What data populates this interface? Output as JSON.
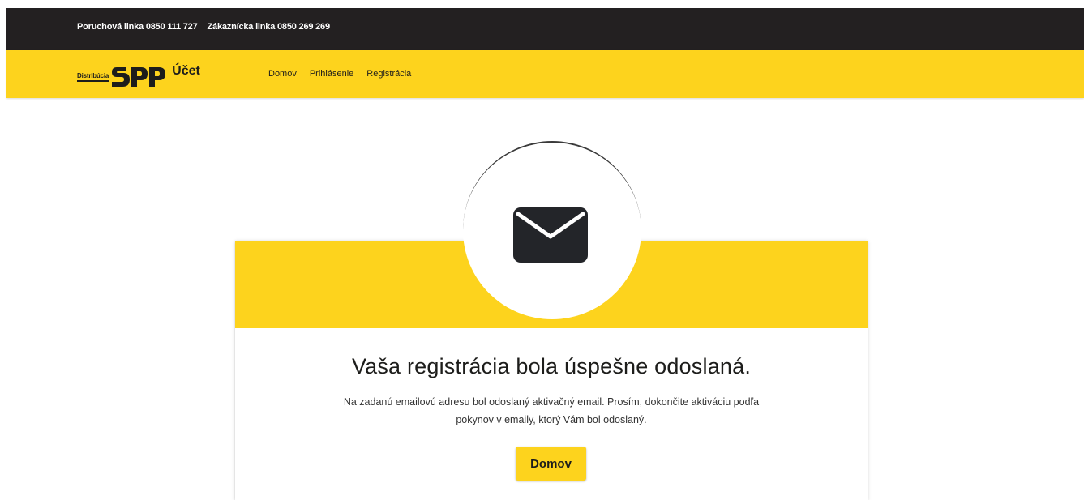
{
  "topbar": {
    "fault_line": "Poruchová linka 0850 111 727",
    "customer_line": "Zákaznícka linka 0850 269 269"
  },
  "brand": {
    "logo_sub": "Distribúcia",
    "logo_main": "SPP",
    "app_name": "Účet"
  },
  "nav": {
    "items": [
      {
        "label": "Domov"
      },
      {
        "label": "Prihlásenie"
      },
      {
        "label": "Registrácia"
      }
    ]
  },
  "card": {
    "icon": "envelope-icon",
    "headline": "Vaša registrácia bola úspešne odoslaná.",
    "message_line1": "Na zadanú emailovú adresu bol odoslaný aktivačný email. Prosím, dokončite aktiváciu podľa",
    "message_line2": "pokynov v emaily, ktorý Vám bol odoslaný.",
    "button_label": "Domov"
  },
  "colors": {
    "accent": "#fdd31d",
    "dark": "#232021"
  }
}
